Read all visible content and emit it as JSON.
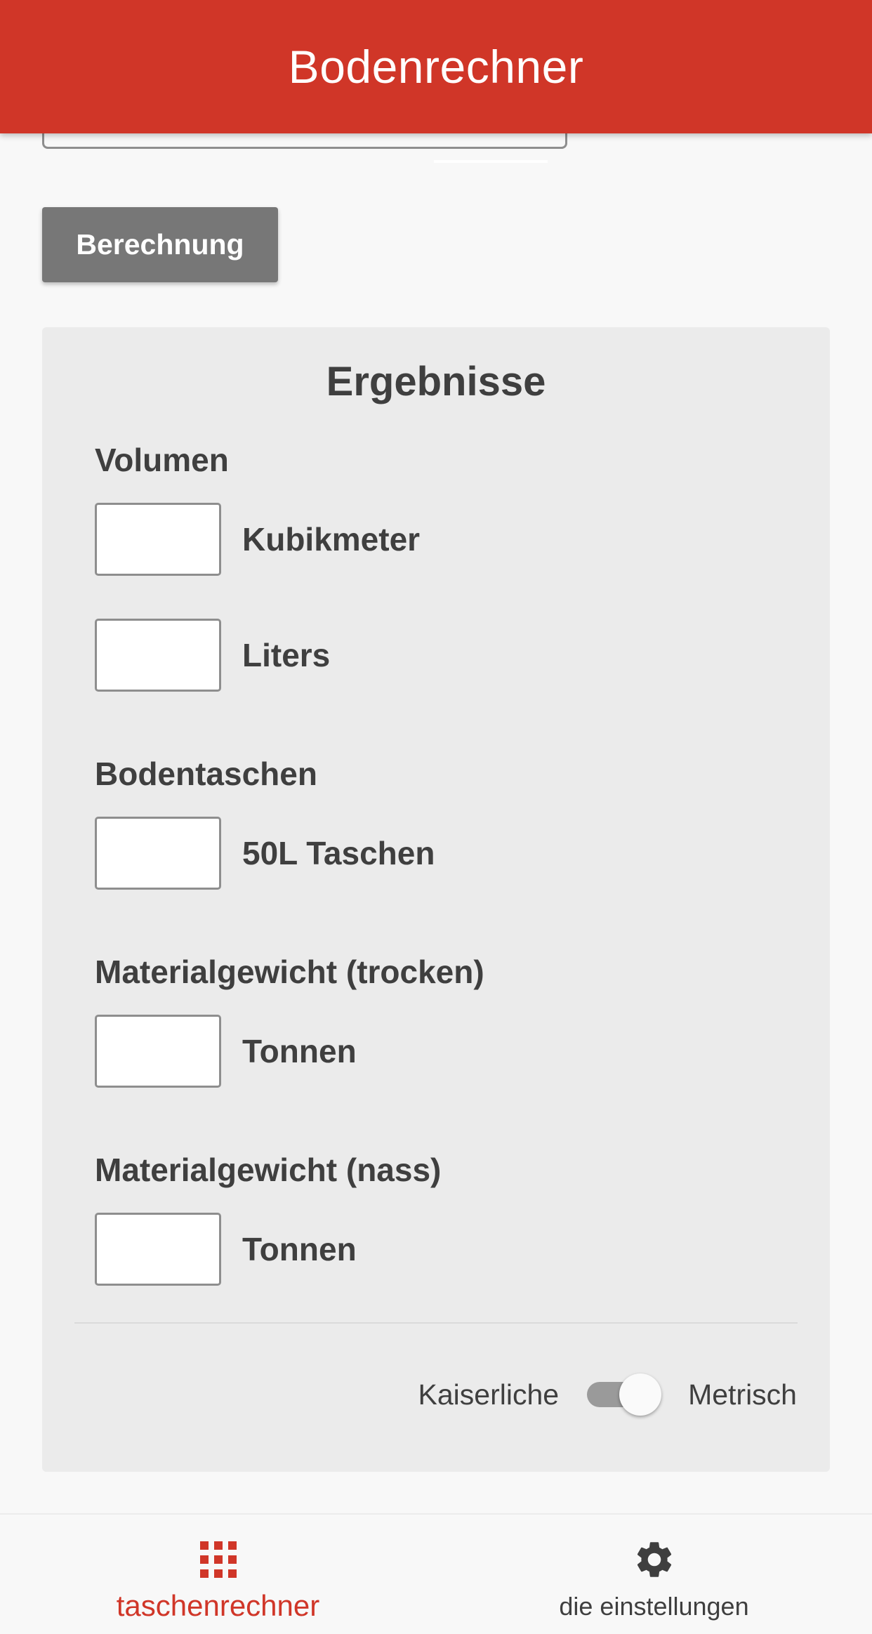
{
  "app_bar": {
    "title": "Bodenrechner"
  },
  "form": {
    "calculate_label": "Berechnung"
  },
  "results": {
    "title": "Ergebnisse",
    "volume": {
      "label": "Volumen",
      "rows": [
        {
          "value": "",
          "unit": "Kubikmeter"
        },
        {
          "value": "",
          "unit": "Liters"
        }
      ]
    },
    "bags": {
      "label": "Bodentaschen",
      "rows": [
        {
          "value": "",
          "unit": "50L Taschen"
        }
      ]
    },
    "weight_dry": {
      "label": "Materialgewicht (trocken)",
      "rows": [
        {
          "value": "",
          "unit": "Tonnen"
        }
      ]
    },
    "weight_wet": {
      "label": "Materialgewicht (nass)",
      "rows": [
        {
          "value": "",
          "unit": "Tonnen"
        }
      ]
    },
    "unit_toggle": {
      "left_label": "Kaiserliche",
      "right_label": "Metrisch",
      "selected": "Metrisch"
    }
  },
  "bottom_nav": {
    "items": [
      {
        "label": "taschenrechner",
        "icon": "grid-icon",
        "active": true
      },
      {
        "label": "die einstellungen",
        "icon": "gear-icon",
        "active": false
      }
    ]
  },
  "colors": {
    "brand": "#d03628",
    "button": "#777777",
    "card": "#ebebeb"
  }
}
